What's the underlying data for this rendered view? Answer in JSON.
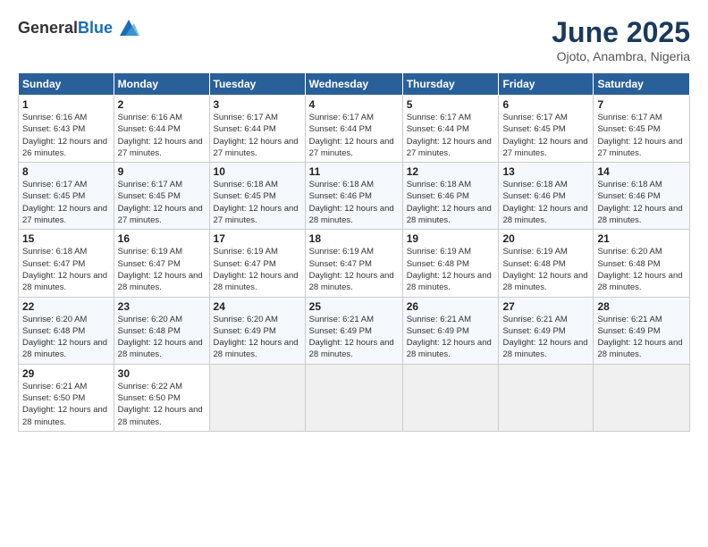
{
  "logo": {
    "line1": "General",
    "line2": "Blue"
  },
  "title": "June 2025",
  "subtitle": "Ojoto, Anambra, Nigeria",
  "weekdays": [
    "Sunday",
    "Monday",
    "Tuesday",
    "Wednesday",
    "Thursday",
    "Friday",
    "Saturday"
  ],
  "weeks": [
    [
      {
        "day": "1",
        "sunrise": "6:16 AM",
        "sunset": "6:43 PM",
        "daylight": "12 hours and 26 minutes."
      },
      {
        "day": "2",
        "sunrise": "6:16 AM",
        "sunset": "6:44 PM",
        "daylight": "12 hours and 27 minutes."
      },
      {
        "day": "3",
        "sunrise": "6:17 AM",
        "sunset": "6:44 PM",
        "daylight": "12 hours and 27 minutes."
      },
      {
        "day": "4",
        "sunrise": "6:17 AM",
        "sunset": "6:44 PM",
        "daylight": "12 hours and 27 minutes."
      },
      {
        "day": "5",
        "sunrise": "6:17 AM",
        "sunset": "6:44 PM",
        "daylight": "12 hours and 27 minutes."
      },
      {
        "day": "6",
        "sunrise": "6:17 AM",
        "sunset": "6:45 PM",
        "daylight": "12 hours and 27 minutes."
      },
      {
        "day": "7",
        "sunrise": "6:17 AM",
        "sunset": "6:45 PM",
        "daylight": "12 hours and 27 minutes."
      }
    ],
    [
      {
        "day": "8",
        "sunrise": "6:17 AM",
        "sunset": "6:45 PM",
        "daylight": "12 hours and 27 minutes."
      },
      {
        "day": "9",
        "sunrise": "6:17 AM",
        "sunset": "6:45 PM",
        "daylight": "12 hours and 27 minutes."
      },
      {
        "day": "10",
        "sunrise": "6:18 AM",
        "sunset": "6:45 PM",
        "daylight": "12 hours and 27 minutes."
      },
      {
        "day": "11",
        "sunrise": "6:18 AM",
        "sunset": "6:46 PM",
        "daylight": "12 hours and 28 minutes."
      },
      {
        "day": "12",
        "sunrise": "6:18 AM",
        "sunset": "6:46 PM",
        "daylight": "12 hours and 28 minutes."
      },
      {
        "day": "13",
        "sunrise": "6:18 AM",
        "sunset": "6:46 PM",
        "daylight": "12 hours and 28 minutes."
      },
      {
        "day": "14",
        "sunrise": "6:18 AM",
        "sunset": "6:46 PM",
        "daylight": "12 hours and 28 minutes."
      }
    ],
    [
      {
        "day": "15",
        "sunrise": "6:18 AM",
        "sunset": "6:47 PM",
        "daylight": "12 hours and 28 minutes."
      },
      {
        "day": "16",
        "sunrise": "6:19 AM",
        "sunset": "6:47 PM",
        "daylight": "12 hours and 28 minutes."
      },
      {
        "day": "17",
        "sunrise": "6:19 AM",
        "sunset": "6:47 PM",
        "daylight": "12 hours and 28 minutes."
      },
      {
        "day": "18",
        "sunrise": "6:19 AM",
        "sunset": "6:47 PM",
        "daylight": "12 hours and 28 minutes."
      },
      {
        "day": "19",
        "sunrise": "6:19 AM",
        "sunset": "6:48 PM",
        "daylight": "12 hours and 28 minutes."
      },
      {
        "day": "20",
        "sunrise": "6:19 AM",
        "sunset": "6:48 PM",
        "daylight": "12 hours and 28 minutes."
      },
      {
        "day": "21",
        "sunrise": "6:20 AM",
        "sunset": "6:48 PM",
        "daylight": "12 hours and 28 minutes."
      }
    ],
    [
      {
        "day": "22",
        "sunrise": "6:20 AM",
        "sunset": "6:48 PM",
        "daylight": "12 hours and 28 minutes."
      },
      {
        "day": "23",
        "sunrise": "6:20 AM",
        "sunset": "6:48 PM",
        "daylight": "12 hours and 28 minutes."
      },
      {
        "day": "24",
        "sunrise": "6:20 AM",
        "sunset": "6:49 PM",
        "daylight": "12 hours and 28 minutes."
      },
      {
        "day": "25",
        "sunrise": "6:21 AM",
        "sunset": "6:49 PM",
        "daylight": "12 hours and 28 minutes."
      },
      {
        "day": "26",
        "sunrise": "6:21 AM",
        "sunset": "6:49 PM",
        "daylight": "12 hours and 28 minutes."
      },
      {
        "day": "27",
        "sunrise": "6:21 AM",
        "sunset": "6:49 PM",
        "daylight": "12 hours and 28 minutes."
      },
      {
        "day": "28",
        "sunrise": "6:21 AM",
        "sunset": "6:49 PM",
        "daylight": "12 hours and 28 minutes."
      }
    ],
    [
      {
        "day": "29",
        "sunrise": "6:21 AM",
        "sunset": "6:50 PM",
        "daylight": "12 hours and 28 minutes."
      },
      {
        "day": "30",
        "sunrise": "6:22 AM",
        "sunset": "6:50 PM",
        "daylight": "12 hours and 28 minutes."
      },
      null,
      null,
      null,
      null,
      null
    ]
  ],
  "labels": {
    "sunrise": "Sunrise:",
    "sunset": "Sunset:",
    "daylight": "Daylight:"
  }
}
